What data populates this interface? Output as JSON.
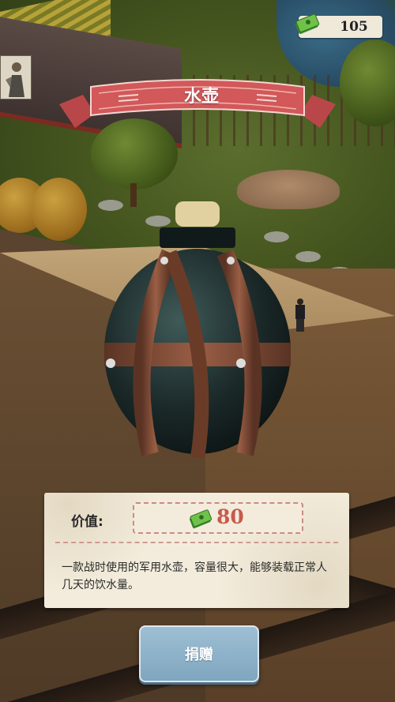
{
  "hud": {
    "money_amount": "105",
    "money_icon": "cash-stack-icon"
  },
  "item": {
    "title": "水壶",
    "value_label": "价值:",
    "value_amount": "80",
    "description": "一款战时使用的军用水壶，容量很大，能够装载正常人几天的饮水量。"
  },
  "actions": {
    "donate_label": "捐赠"
  },
  "colors": {
    "ribbon": "#d2585a",
    "value_text": "#c9594d",
    "button": "#8fb2c9",
    "card": "#f3ecdc"
  }
}
